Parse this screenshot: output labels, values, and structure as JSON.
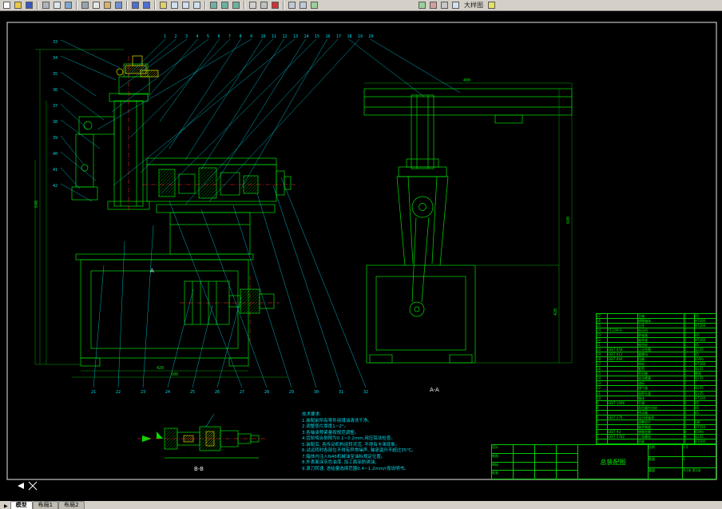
{
  "toolbar": {
    "items": [
      {
        "type": "icon",
        "name": "new-file",
        "color": "#fdfdfd"
      },
      {
        "type": "icon",
        "name": "open-file",
        "color": "#e8c84a"
      },
      {
        "type": "icon",
        "name": "save-file",
        "color": "#3a57c0"
      },
      {
        "type": "sep"
      },
      {
        "type": "icon",
        "name": "print",
        "color": "#b0b4bc"
      },
      {
        "type": "icon",
        "name": "print-preview",
        "color": "#dfe6ef"
      },
      {
        "type": "icon",
        "name": "publish",
        "color": "#7fa6d0"
      },
      {
        "type": "sep"
      },
      {
        "type": "icon",
        "name": "cut",
        "color": "#9aa4b0"
      },
      {
        "type": "icon",
        "name": "copy",
        "color": "#e6e6e6"
      },
      {
        "type": "icon",
        "name": "paste",
        "color": "#d9b06a"
      },
      {
        "type": "icon",
        "name": "match-properties",
        "color": "#6f8fd0"
      },
      {
        "type": "sep"
      },
      {
        "type": "icon",
        "name": "undo",
        "color": "#4d6fd0"
      },
      {
        "type": "icon",
        "name": "redo",
        "color": "#4d6fd0"
      },
      {
        "type": "sep"
      },
      {
        "type": "icon",
        "name": "pan-realtime",
        "color": "#e0d06a"
      },
      {
        "type": "icon",
        "name": "zoom-realtime",
        "color": "#cfe0ef"
      },
      {
        "type": "icon",
        "name": "zoom-window",
        "color": "#cfe0ef"
      },
      {
        "type": "icon",
        "name": "zoom-previous",
        "color": "#cfe0ef"
      },
      {
        "type": "sep"
      },
      {
        "type": "icon",
        "name": "properties",
        "color": "#6fb0a0"
      },
      {
        "type": "icon",
        "name": "design-center",
        "color": "#6fb0a0"
      },
      {
        "type": "icon",
        "name": "tool-palettes",
        "color": "#6fb0a0"
      },
      {
        "type": "sep"
      },
      {
        "type": "icon",
        "name": "layer-manager",
        "color": "#d0d0d0"
      },
      {
        "type": "icon",
        "name": "layer-previous",
        "color": "#c0c0c0"
      },
      {
        "type": "icon",
        "name": "color-control",
        "color": "#cc3333"
      },
      {
        "type": "sep"
      },
      {
        "type": "icon",
        "name": "make-block",
        "color": "#c0c8d8"
      },
      {
        "type": "icon",
        "name": "insert-block",
        "color": "#c0c8d8"
      },
      {
        "type": "icon",
        "name": "hatch",
        "color": "#9ad09a"
      },
      {
        "type": "gap"
      },
      {
        "type": "icon",
        "name": "dimension-style",
        "color": "#9ad09a"
      },
      {
        "type": "icon",
        "name": "text-style",
        "color": "#d0a0a0"
      },
      {
        "type": "icon",
        "name": "table-style",
        "color": "#c8c8c8"
      },
      {
        "type": "icon",
        "name": "named-views",
        "color": "#cfe0ef"
      },
      {
        "type": "label",
        "name": "toolbar-text",
        "text": "大样图"
      },
      {
        "type": "icon",
        "name": "help",
        "color": "#e8e060"
      }
    ]
  },
  "drawing": {
    "view_label_front": "A",
    "view_label_side": "A-A",
    "view_label_section": "B-B",
    "dims": {
      "front_height": "640",
      "front_width": "420",
      "base_width": "500",
      "side_height": "680",
      "side_base_height": "420",
      "top_width": "400"
    },
    "balloons_top": [
      "1",
      "2",
      "3",
      "4",
      "5",
      "6",
      "7",
      "8",
      "9",
      "10",
      "11",
      "12",
      "13",
      "14",
      "15",
      "16",
      "17",
      "18",
      "19",
      "20"
    ],
    "balloons_bottom": [
      "21",
      "22",
      "23",
      "24",
      "25",
      "26",
      "27",
      "28",
      "29",
      "30",
      "31",
      "32"
    ],
    "balloons_left": [
      "33",
      "34",
      "35",
      "36",
      "37",
      "38",
      "39",
      "40",
      "41",
      "42"
    ]
  },
  "notes": {
    "title": "技术要求:",
    "lines": [
      "1.装配前所有零件用煤油清洗干净。",
      "2.调整垫片厚度1~2°。",
      "3.各轴承预紧量按规范调整。",
      "4.齿轮啮合侧隙为0.1~0.2mm,用压铅法检查。",
      "5.装配后, 各传动机构运转灵活, 不得有卡滞现象。",
      "6.试运转时各部位不得有异常噪声, 轴承温升不超过35℃。",
      "7.箱体内注入N46机械油至油标规定位置。",
      "8.外表面涂灰色油漆, 加工面涂防锈油。",
      "9.滚刀转速, 进给量选择范围0.4~1.2mm/r按说明书。"
    ]
  },
  "bom": {
    "rows": [
      {
        "no": "27",
        "code": "",
        "name": "主轴",
        "qty": "1",
        "mat": "45"
      },
      {
        "no": "26",
        "code": "",
        "name": "横臂箱体",
        "qty": "1",
        "mat": "HT200"
      },
      {
        "no": "25",
        "code": "",
        "name": "立柱",
        "qty": "1",
        "mat": "HT200"
      },
      {
        "no": "24",
        "code": "Y112M-4",
        "name": "电动机",
        "qty": "1",
        "mat": ""
      },
      {
        "no": "23",
        "code": "",
        "name": "联轴器",
        "qty": "1",
        "mat": "45"
      },
      {
        "no": "22",
        "code": "",
        "name": "轴承座",
        "qty": "2",
        "mat": "HT200"
      },
      {
        "no": "21",
        "code": "",
        "name": "锥齿轮",
        "qty": "2",
        "mat": "45"
      },
      {
        "no": "20",
        "code": "GB/T 858",
        "name": "止动垫圈",
        "qty": "2",
        "mat": "Q235"
      },
      {
        "no": "19",
        "code": "GB/T 812",
        "name": "圆螺母",
        "qty": "2",
        "mat": "45"
      },
      {
        "no": "18",
        "code": "GB/T 894",
        "name": "挡圈",
        "qty": "2",
        "mat": "65Mn"
      },
      {
        "no": "17",
        "code": "",
        "name": "带轮",
        "qty": "1",
        "mat": "HT200"
      },
      {
        "no": "16",
        "code": "",
        "name": "套筒",
        "qty": "2",
        "mat": "Q235"
      },
      {
        "no": "15",
        "code": "",
        "name": "密封圈",
        "qty": "2",
        "mat": "橡胶"
      },
      {
        "no": "14",
        "code": "",
        "name": "放油螺塞",
        "qty": "1",
        "mat": "Q235"
      },
      {
        "no": "13",
        "code": "",
        "name": "油标",
        "qty": "1",
        "mat": ""
      },
      {
        "no": "12",
        "code": "",
        "name": "通气器",
        "qty": "1",
        "mat": "Q235"
      },
      {
        "no": "11",
        "code": "",
        "name": "观察孔盖",
        "qty": "1",
        "mat": "Q235"
      },
      {
        "no": "10",
        "code": "",
        "name": "箱体",
        "qty": "1",
        "mat": "HT200"
      },
      {
        "no": "9",
        "code": "GB/T 1096",
        "name": "平键",
        "qty": "4",
        "mat": "45"
      },
      {
        "no": "8",
        "code": "",
        "name": "直齿圆柱齿轮",
        "qty": "2",
        "mat": "45"
      },
      {
        "no": "7",
        "code": "",
        "name": "传动轴",
        "qty": "2",
        "mat": "45"
      },
      {
        "no": "6",
        "code": "GB/T 276",
        "name": "深沟球轴承",
        "qty": "4",
        "mat": ""
      },
      {
        "no": "5",
        "code": "",
        "name": "调整垫片",
        "qty": "2",
        "mat": "08F"
      },
      {
        "no": "4",
        "code": "",
        "name": "轴承端盖",
        "qty": "4",
        "mat": "HT150"
      },
      {
        "no": "3",
        "code": "GB/T 93",
        "name": "弹簧垫圈",
        "qty": "8",
        "mat": "65Mn"
      },
      {
        "no": "2",
        "code": "GB/T 5782",
        "name": "六角螺栓",
        "qty": "8",
        "mat": "Q235"
      },
      {
        "no": "1",
        "code": "",
        "name": "机座",
        "qty": "1",
        "mat": "HT200"
      }
    ]
  },
  "title_block": {
    "drawing_title": "总装配图",
    "scale_label": "比例",
    "scale_value": "1:2",
    "qty_label": "数量",
    "qty_value": "1",
    "weight_label": "重量",
    "sheet_label": "共1张 第1张",
    "sig_rows": [
      [
        "设计",
        "",
        "",
        ""
      ],
      [
        "制图",
        "",
        "",
        ""
      ],
      [
        "审核",
        "",
        "",
        ""
      ],
      [
        "批准",
        "",
        "",
        ""
      ]
    ]
  },
  "tabs": {
    "nav": "▶",
    "model": "模型",
    "layout1": "布局1",
    "layout2": "布局2"
  }
}
